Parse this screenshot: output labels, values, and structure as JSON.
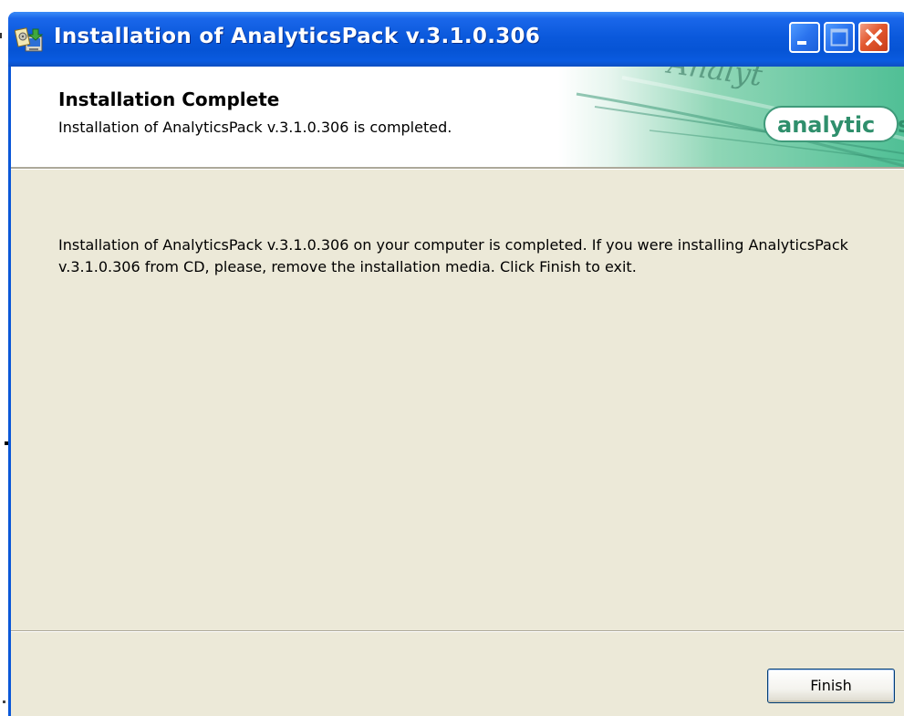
{
  "window": {
    "title": "Installation of AnalyticsPack v.3.1.0.306",
    "title_icon": "installer-icon",
    "controls": {
      "minimize": "minimize-icon",
      "maximize": "maximize-icon",
      "close": "close-icon"
    }
  },
  "header": {
    "title": "Installation Complete",
    "subtitle": "Installation of AnalyticsPack v.3.1.0.306 is completed.",
    "banner_logo_text": "analytic",
    "banner_script_text": "Analyt"
  },
  "body": {
    "message": "Installation of AnalyticsPack v.3.1.0.306 on your computer is completed. If you were installing AnalyticsPack v.3.1.0.306 from CD, please, remove the installation media. Click Finish to exit."
  },
  "footer": {
    "finish_label": "Finish"
  },
  "colors": {
    "titlebar_blue": "#0654d5",
    "dialog_face": "#ece9d8",
    "banner_green": "#4fbf95",
    "close_red": "#e2582f"
  }
}
